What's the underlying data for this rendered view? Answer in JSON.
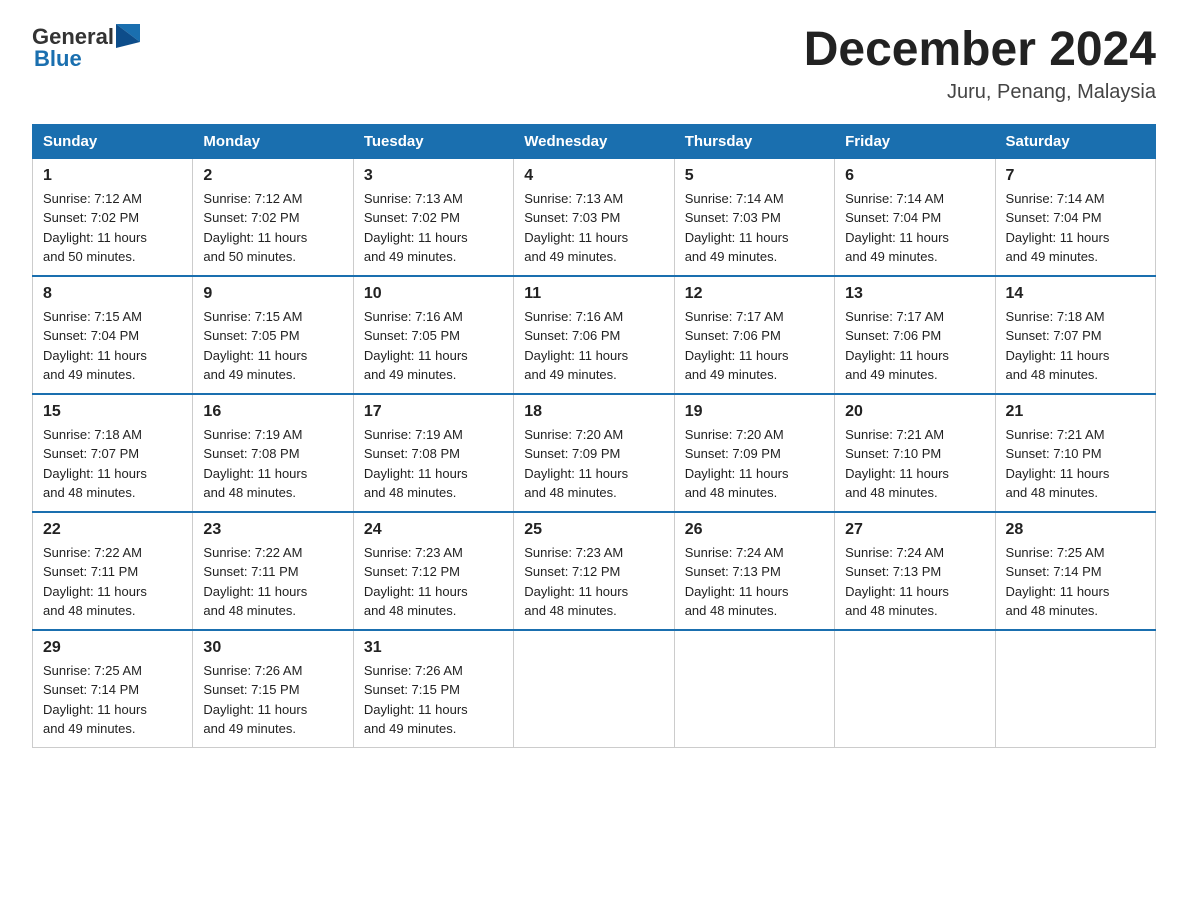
{
  "header": {
    "logo_general": "General",
    "logo_blue": "Blue",
    "title": "December 2024",
    "subtitle": "Juru, Penang, Malaysia"
  },
  "weekdays": [
    "Sunday",
    "Monday",
    "Tuesday",
    "Wednesday",
    "Thursday",
    "Friday",
    "Saturday"
  ],
  "weeks": [
    [
      {
        "day": "1",
        "info": "Sunrise: 7:12 AM\nSunset: 7:02 PM\nDaylight: 11 hours\nand 50 minutes."
      },
      {
        "day": "2",
        "info": "Sunrise: 7:12 AM\nSunset: 7:02 PM\nDaylight: 11 hours\nand 50 minutes."
      },
      {
        "day": "3",
        "info": "Sunrise: 7:13 AM\nSunset: 7:02 PM\nDaylight: 11 hours\nand 49 minutes."
      },
      {
        "day": "4",
        "info": "Sunrise: 7:13 AM\nSunset: 7:03 PM\nDaylight: 11 hours\nand 49 minutes."
      },
      {
        "day": "5",
        "info": "Sunrise: 7:14 AM\nSunset: 7:03 PM\nDaylight: 11 hours\nand 49 minutes."
      },
      {
        "day": "6",
        "info": "Sunrise: 7:14 AM\nSunset: 7:04 PM\nDaylight: 11 hours\nand 49 minutes."
      },
      {
        "day": "7",
        "info": "Sunrise: 7:14 AM\nSunset: 7:04 PM\nDaylight: 11 hours\nand 49 minutes."
      }
    ],
    [
      {
        "day": "8",
        "info": "Sunrise: 7:15 AM\nSunset: 7:04 PM\nDaylight: 11 hours\nand 49 minutes."
      },
      {
        "day": "9",
        "info": "Sunrise: 7:15 AM\nSunset: 7:05 PM\nDaylight: 11 hours\nand 49 minutes."
      },
      {
        "day": "10",
        "info": "Sunrise: 7:16 AM\nSunset: 7:05 PM\nDaylight: 11 hours\nand 49 minutes."
      },
      {
        "day": "11",
        "info": "Sunrise: 7:16 AM\nSunset: 7:06 PM\nDaylight: 11 hours\nand 49 minutes."
      },
      {
        "day": "12",
        "info": "Sunrise: 7:17 AM\nSunset: 7:06 PM\nDaylight: 11 hours\nand 49 minutes."
      },
      {
        "day": "13",
        "info": "Sunrise: 7:17 AM\nSunset: 7:06 PM\nDaylight: 11 hours\nand 49 minutes."
      },
      {
        "day": "14",
        "info": "Sunrise: 7:18 AM\nSunset: 7:07 PM\nDaylight: 11 hours\nand 48 minutes."
      }
    ],
    [
      {
        "day": "15",
        "info": "Sunrise: 7:18 AM\nSunset: 7:07 PM\nDaylight: 11 hours\nand 48 minutes."
      },
      {
        "day": "16",
        "info": "Sunrise: 7:19 AM\nSunset: 7:08 PM\nDaylight: 11 hours\nand 48 minutes."
      },
      {
        "day": "17",
        "info": "Sunrise: 7:19 AM\nSunset: 7:08 PM\nDaylight: 11 hours\nand 48 minutes."
      },
      {
        "day": "18",
        "info": "Sunrise: 7:20 AM\nSunset: 7:09 PM\nDaylight: 11 hours\nand 48 minutes."
      },
      {
        "day": "19",
        "info": "Sunrise: 7:20 AM\nSunset: 7:09 PM\nDaylight: 11 hours\nand 48 minutes."
      },
      {
        "day": "20",
        "info": "Sunrise: 7:21 AM\nSunset: 7:10 PM\nDaylight: 11 hours\nand 48 minutes."
      },
      {
        "day": "21",
        "info": "Sunrise: 7:21 AM\nSunset: 7:10 PM\nDaylight: 11 hours\nand 48 minutes."
      }
    ],
    [
      {
        "day": "22",
        "info": "Sunrise: 7:22 AM\nSunset: 7:11 PM\nDaylight: 11 hours\nand 48 minutes."
      },
      {
        "day": "23",
        "info": "Sunrise: 7:22 AM\nSunset: 7:11 PM\nDaylight: 11 hours\nand 48 minutes."
      },
      {
        "day": "24",
        "info": "Sunrise: 7:23 AM\nSunset: 7:12 PM\nDaylight: 11 hours\nand 48 minutes."
      },
      {
        "day": "25",
        "info": "Sunrise: 7:23 AM\nSunset: 7:12 PM\nDaylight: 11 hours\nand 48 minutes."
      },
      {
        "day": "26",
        "info": "Sunrise: 7:24 AM\nSunset: 7:13 PM\nDaylight: 11 hours\nand 48 minutes."
      },
      {
        "day": "27",
        "info": "Sunrise: 7:24 AM\nSunset: 7:13 PM\nDaylight: 11 hours\nand 48 minutes."
      },
      {
        "day": "28",
        "info": "Sunrise: 7:25 AM\nSunset: 7:14 PM\nDaylight: 11 hours\nand 48 minutes."
      }
    ],
    [
      {
        "day": "29",
        "info": "Sunrise: 7:25 AM\nSunset: 7:14 PM\nDaylight: 11 hours\nand 49 minutes."
      },
      {
        "day": "30",
        "info": "Sunrise: 7:26 AM\nSunset: 7:15 PM\nDaylight: 11 hours\nand 49 minutes."
      },
      {
        "day": "31",
        "info": "Sunrise: 7:26 AM\nSunset: 7:15 PM\nDaylight: 11 hours\nand 49 minutes."
      },
      {
        "day": "",
        "info": ""
      },
      {
        "day": "",
        "info": ""
      },
      {
        "day": "",
        "info": ""
      },
      {
        "day": "",
        "info": ""
      }
    ]
  ],
  "colors": {
    "header_bg": "#1a6faf",
    "logo_blue": "#1a6faf"
  }
}
